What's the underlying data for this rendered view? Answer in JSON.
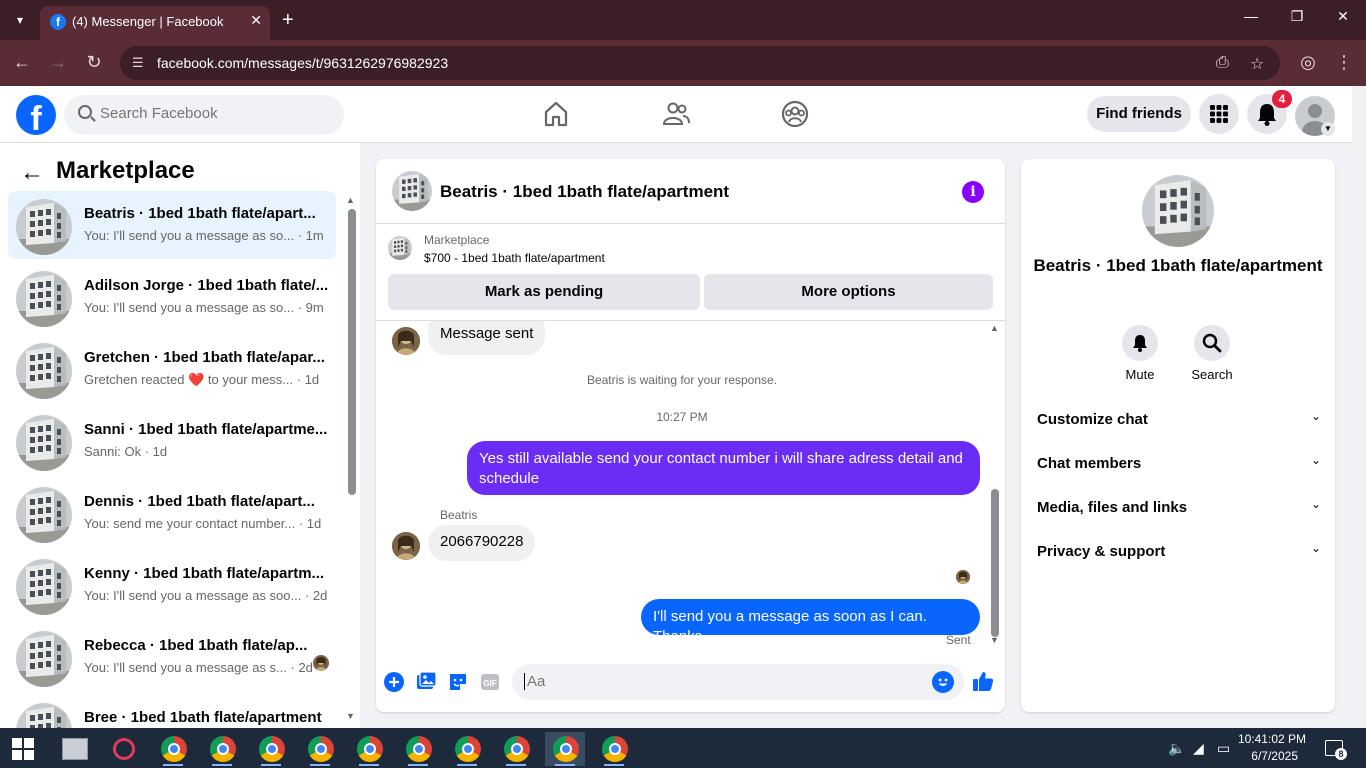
{
  "browser": {
    "tab_title": "(4) Messenger | Facebook",
    "tab_favicon": "f",
    "url": "facebook.com/messages/t/9631262976982923"
  },
  "fb_header": {
    "search_placeholder": "Search Facebook",
    "find_friends_label": "Find friends",
    "notification_count": "4"
  },
  "left": {
    "title": "Marketplace",
    "conversations": [
      {
        "name": "Beatris · 1bed 1bath flate/apart...",
        "preview": "You: I'll send you a message as so... · 1m"
      },
      {
        "name": "Adilson Jorge · 1bed 1bath flate/...",
        "preview": "You: I'll send you a message as so... · 9m"
      },
      {
        "name": "Gretchen · 1bed 1bath flate/apar...",
        "preview_pre": "Gretchen reacted",
        "preview_post": "to your mess... · 1d",
        "reaction": "❤️"
      },
      {
        "name": "Sanni · 1bed 1bath flate/apartme...",
        "preview": "Sanni: Ok · 1d"
      },
      {
        "name": "Dennis · 1bed 1bath flate/apart...",
        "preview": "You: send me your contact number... · 1d"
      },
      {
        "name": "Kenny · 1bed 1bath flate/apartm...",
        "preview": "You: I'll send you a message as soo... · 2d"
      },
      {
        "name": "Rebecca · 1bed 1bath flate/ap...",
        "preview": "You: I'll send you a message as s... · 2d"
      },
      {
        "name": "Bree · 1bed 1bath flate/apartment",
        "preview": ""
      }
    ]
  },
  "chat": {
    "title": "Beatris · 1bed 1bath flate/apartment",
    "marketplace_label": "Marketplace",
    "listing": "$700 - 1bed 1bath flate/apartment",
    "mark_pending_label": "Mark as pending",
    "more_options_label": "More options",
    "messages": {
      "first_in": "Message sent",
      "waiting": "Beatris is waiting for your response.",
      "time": "10:27 PM",
      "out_1": "Yes still available send your contact number i will share adress detail and schedule",
      "sender": "Beatris",
      "in_number": "2066790228",
      "out_2": "I'll send you a message as soon as I can. Thanks",
      "status": "Sent"
    },
    "composer_placeholder": "Aa"
  },
  "right": {
    "title": "Beatris · 1bed 1bath flate/apartment",
    "mute_label": "Mute",
    "search_label": "Search",
    "sections": [
      "Customize chat",
      "Chat members",
      "Media, files and links",
      "Privacy & support"
    ]
  },
  "taskbar": {
    "time": "10:41:02 PM",
    "date": "6/7/2025",
    "notifications": "8"
  },
  "colors": {
    "fb_blue": "#0866ff",
    "purple_bubble": "#6b2cf5",
    "badge_red": "#e41e3f",
    "browser_frame": "#3c1f26"
  }
}
